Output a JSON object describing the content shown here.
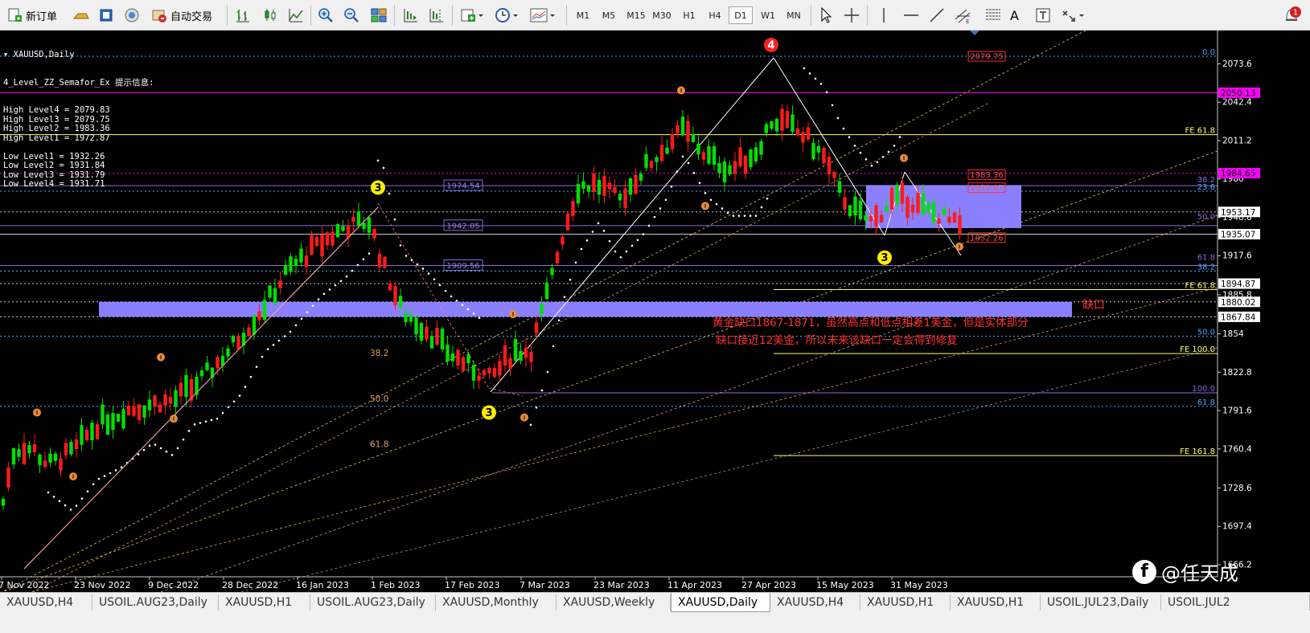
{
  "toolbar": {
    "new_order": "新订单",
    "auto_trading": "自动交易",
    "timeframes": [
      "M1",
      "M5",
      "M15",
      "M30",
      "H1",
      "H4",
      "D1",
      "W1",
      "MN"
    ],
    "active_timeframe": "D1",
    "text_tool": "A",
    "alert_badge": "1"
  },
  "indicator": {
    "symbol": "XAUUSD,Daily",
    "name": "4_Level_ZZ_Semafor_Ex 提示信息:",
    "lines": [
      "High Level4 = 2079.83",
      "High Level3 = 2079.75",
      "High Level2 = 1983.36",
      "High Level1 = 1972.87",
      "",
      "Low Level1 = 1932.26",
      "Low Level2 = 1931.84",
      "Low Level3 = 1931.79",
      "Low Level4 = 1931.71"
    ]
  },
  "chart_data": {
    "type": "candlestick",
    "symbol": "XAUUSD",
    "timeframe": "Daily",
    "ylim": [
      1655,
      2100
    ],
    "y_ticks": [
      2073.6,
      2042.4,
      2011.2,
      1980.0,
      1948.8,
      1917.6,
      1885.8,
      1854.0,
      1822.8,
      1791.6,
      1760.4,
      1728.6,
      1697.4,
      1666.2
    ],
    "x_ticks": [
      "7 Nov 2022",
      "23 Nov 2022",
      "9 Dec 2022",
      "28 Dec 2022",
      "16 Jan 2023",
      "1 Feb 2023",
      "17 Feb 2023",
      "7 Mar 2023",
      "23 Mar 2023",
      "11 Apr 2023",
      "27 Apr 2023",
      "15 May 2023",
      "31 May 2023"
    ],
    "price_boxes": [
      {
        "value": "2050.13",
        "price": 2050.13,
        "bg": "#ff00ff",
        "color": "#000000"
      },
      {
        "value": "1984.65",
        "price": 1984.65,
        "bg": "#ff00ff",
        "color": "#000000"
      },
      {
        "value": "1953.17",
        "price": 1953.17,
        "bg": "#ffffff",
        "color": "#000000"
      },
      {
        "value": "1935.07",
        "price": 1935.07,
        "bg": "#ffffff",
        "color": "#000000"
      },
      {
        "value": "1894.87",
        "price": 1894.87,
        "bg": "#ffffff",
        "color": "#000000"
      },
      {
        "value": "1880.02",
        "price": 1880.02,
        "bg": "#ffffff",
        "color": "#000000"
      },
      {
        "value": "1867.84",
        "price": 1867.84,
        "bg": "#ffffff",
        "color": "#000000"
      }
    ],
    "fib_right_labels": [
      {
        "text": "0.0",
        "price": 2079.8,
        "color": "#4fa6ff"
      },
      {
        "text": "FE 61.8",
        "price": 2016,
        "color": "#ffff66"
      },
      {
        "text": "38.2",
        "price": 1976,
        "color": "#8a6ad8"
      },
      {
        "text": "23.6",
        "price": 1970,
        "color": "#4fa6ff"
      },
      {
        "text": "50.0",
        "price": 1946,
        "color": "#8a6ad8"
      },
      {
        "text": "61.8",
        "price": 1913,
        "color": "#8a6ad8"
      },
      {
        "text": "38.2",
        "price": 1905,
        "color": "#4fa6ff"
      },
      {
        "text": "FE 61.8",
        "price": 1890,
        "color": "#ffff66"
      },
      {
        "text": "50.0",
        "price": 1852,
        "color": "#4fa6ff"
      },
      {
        "text": "FE 100.0",
        "price": 1838,
        "color": "#ffff66"
      },
      {
        "text": "100.0",
        "price": 1806,
        "color": "#8a6ad8"
      },
      {
        "text": "61.8",
        "price": 1795,
        "color": "#4fa6ff"
      },
      {
        "text": "FE 161.8",
        "price": 1755,
        "color": "#ffff66"
      }
    ],
    "fib_left_labels": [
      {
        "text": "38.2",
        "price": 1836,
        "color": "#d9a06a"
      },
      {
        "text": "50.0",
        "price": 1799,
        "color": "#d9a06a"
      },
      {
        "text": "61.8",
        "price": 1762,
        "color": "#d9a06a"
      }
    ],
    "level_labels": [
      {
        "text": "1974.54",
        "price": 1974.54
      },
      {
        "text": "1942.05",
        "price": 1942.05
      },
      {
        "text": "1909.56",
        "price": 1909.56
      }
    ],
    "box_labels": [
      {
        "text": "2079.75",
        "price": 2079.75
      },
      {
        "text": "1983.36",
        "price": 1983.36
      },
      {
        "text": "1972.87",
        "price": 1972.87
      },
      {
        "text": "1932.26",
        "price": 1932.26
      }
    ],
    "semafor_markers": [
      {
        "label": "4",
        "x": 959,
        "price": 2089,
        "level": 4
      },
      {
        "label": "3",
        "x": 470,
        "price": 1973,
        "level": 3
      },
      {
        "label": "3",
        "x": 608,
        "price": 1790,
        "level": 3
      },
      {
        "label": "3",
        "x": 1100,
        "price": 1916,
        "level": 3
      }
    ],
    "gap_label": "缺口",
    "annotation_line1": "黄金缺口1867-1871，虽然高点和低点相差1美金，但是实体部分",
    "annotation_line2": "缺口接近12美金，所以未来该缺口一定会得到修复",
    "gap_zone": [
      1867.84,
      1880.02
    ]
  },
  "tabs": [
    {
      "label": "XAUUSD,H4",
      "active": false
    },
    {
      "label": "USOIL.AUG23,Daily",
      "active": false
    },
    {
      "label": "XAUUSD,H1",
      "active": false
    },
    {
      "label": "USOIL.AUG23,Daily",
      "active": false
    },
    {
      "label": "XAUUSD,Monthly",
      "active": false
    },
    {
      "label": "XAUUSD,Weekly",
      "active": false
    },
    {
      "label": "XAUUSD,Daily",
      "active": true
    },
    {
      "label": "XAUUSD,H4",
      "active": false
    },
    {
      "label": "XAUUSD,H1",
      "active": false
    },
    {
      "label": "XAUUSD,H1",
      "active": false
    },
    {
      "label": "USOIL.JUL23,Daily",
      "active": false
    },
    {
      "label": "USOIL.JUL2",
      "active": false
    }
  ],
  "watermark": "@任天成"
}
